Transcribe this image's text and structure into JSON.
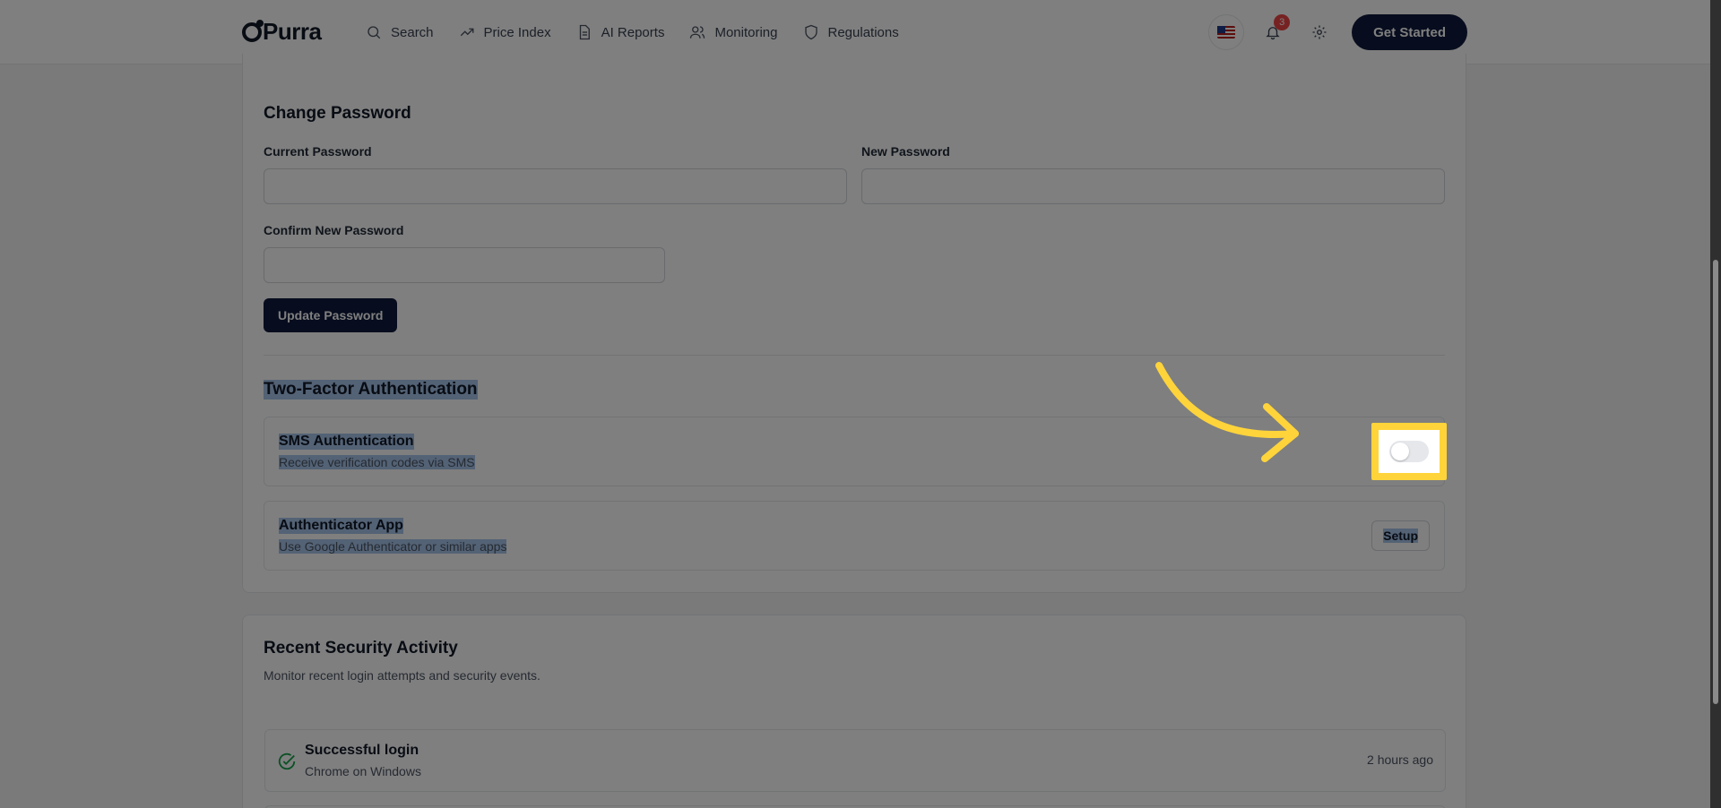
{
  "header": {
    "brand": "Purra",
    "nav": [
      {
        "label": "Search",
        "icon": "search-icon"
      },
      {
        "label": "Price Index",
        "icon": "trend-icon"
      },
      {
        "label": "AI Reports",
        "icon": "document-icon"
      },
      {
        "label": "Monitoring",
        "icon": "users-icon"
      },
      {
        "label": "Regulations",
        "icon": "shield-icon"
      }
    ],
    "notification_count": "3",
    "cta_label": "Get Started",
    "flag": "US flag"
  },
  "change_password": {
    "title": "Change Password",
    "current_label": "Current Password",
    "new_label": "New Password",
    "confirm_label": "Confirm New Password",
    "current_value": "",
    "new_value": "",
    "confirm_value": "",
    "submit_label": "Update Password"
  },
  "two_factor": {
    "title": "Two-Factor Authentication",
    "sms": {
      "title": "SMS Authentication",
      "subtitle": "Receive verification codes via SMS",
      "enabled": false
    },
    "app": {
      "title": "Authenticator App",
      "subtitle": "Use Google Authenticator or similar apps",
      "action_label": "Setup"
    }
  },
  "activity": {
    "title": "Recent Security Activity",
    "subtitle": "Monitor recent login attempts and security events.",
    "items": [
      {
        "title": "Successful login",
        "detail": "Chrome on Windows",
        "time": "2 hours ago"
      }
    ]
  },
  "colors": {
    "primary": "#0f1b3d",
    "highlight": "#ffd43b",
    "success": "#16a34a",
    "badge": "#ef4444"
  }
}
